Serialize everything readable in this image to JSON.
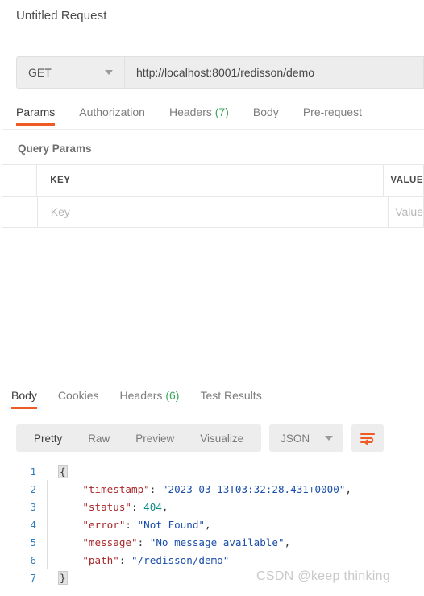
{
  "request": {
    "title": "Untitled Request",
    "method": "GET",
    "url": "http://localhost:8001/redisson/demo",
    "tabs": [
      {
        "label": "Params",
        "active": true
      },
      {
        "label": "Authorization",
        "active": false
      },
      {
        "label": "Headers",
        "count": "(7)",
        "active": false
      },
      {
        "label": "Body",
        "active": false
      },
      {
        "label": "Pre-request",
        "active": false
      }
    ],
    "query_params": {
      "section_label": "Query Params",
      "columns": [
        "KEY",
        "VALUE"
      ],
      "rows": [
        {
          "key_placeholder": "Key",
          "value_placeholder": "Value"
        }
      ]
    }
  },
  "response": {
    "tabs": [
      {
        "label": "Body",
        "active": true
      },
      {
        "label": "Cookies",
        "active": false
      },
      {
        "label": "Headers",
        "count": "(6)",
        "active": false
      },
      {
        "label": "Test Results",
        "active": false
      }
    ],
    "view_modes": [
      {
        "label": "Pretty",
        "active": true
      },
      {
        "label": "Raw",
        "active": false
      },
      {
        "label": "Preview",
        "active": false
      },
      {
        "label": "Visualize",
        "active": false
      }
    ],
    "format": "JSON",
    "wrap_icon": "wrap-text-icon",
    "body": {
      "line_numbers": [
        "1",
        "2",
        "3",
        "4",
        "5",
        "6",
        "7"
      ],
      "lines": [
        {
          "n": "1",
          "type": "brace-open",
          "text": "{"
        },
        {
          "n": "2",
          "type": "pair",
          "indent": "    ",
          "key": "\"timestamp\"",
          "sep": ": ",
          "value": "\"2023-03-13T03:32:28.431+0000\"",
          "value_kind": "string",
          "trail": ","
        },
        {
          "n": "3",
          "type": "pair",
          "indent": "    ",
          "key": "\"status\"",
          "sep": ": ",
          "value": "404",
          "value_kind": "number",
          "trail": ","
        },
        {
          "n": "4",
          "type": "pair",
          "indent": "    ",
          "key": "\"error\"",
          "sep": ": ",
          "value": "\"Not Found\"",
          "value_kind": "string",
          "trail": ","
        },
        {
          "n": "5",
          "type": "pair",
          "indent": "    ",
          "key": "\"message\"",
          "sep": ": ",
          "value": "\"No message available\"",
          "value_kind": "string",
          "trail": ","
        },
        {
          "n": "6",
          "type": "pair",
          "indent": "    ",
          "key": "\"path\"",
          "sep": ": ",
          "value": "\"/redisson/demo\"",
          "value_kind": "link",
          "trail": ""
        },
        {
          "n": "7",
          "type": "brace-close",
          "text": "}"
        }
      ]
    }
  },
  "watermark": "CSDN @keep   thinking",
  "colors": {
    "accent": "#ef5b25",
    "count_green": "#3ba55c",
    "json_key": "#a8292b",
    "json_string": "#1a4ea8",
    "json_number": "#0f8a8a",
    "line_number": "#2f7fc0"
  }
}
